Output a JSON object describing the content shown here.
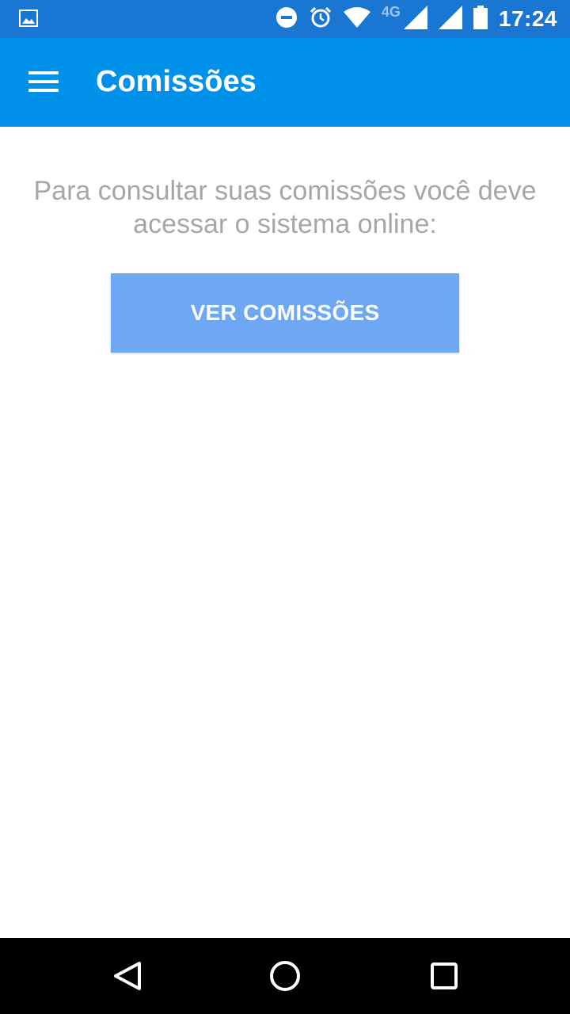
{
  "status_bar": {
    "time": "17:24",
    "network": "4G",
    "icons": [
      "image-notification-icon",
      "do-not-disturb-icon",
      "alarm-icon",
      "wifi-icon",
      "signal-icon",
      "signal-icon-2",
      "battery-icon"
    ]
  },
  "app_bar": {
    "title": "Comissões",
    "menu_icon": "menu-icon",
    "color": "#0091ea"
  },
  "content": {
    "message": "Para consultar suas comissões você deve acessar o sistema online:",
    "button_label": "VER COMISSÕES",
    "button_color": "#6ea8f3"
  },
  "nav_bar": {
    "icons": [
      "back-icon",
      "home-icon",
      "recents-icon"
    ]
  }
}
